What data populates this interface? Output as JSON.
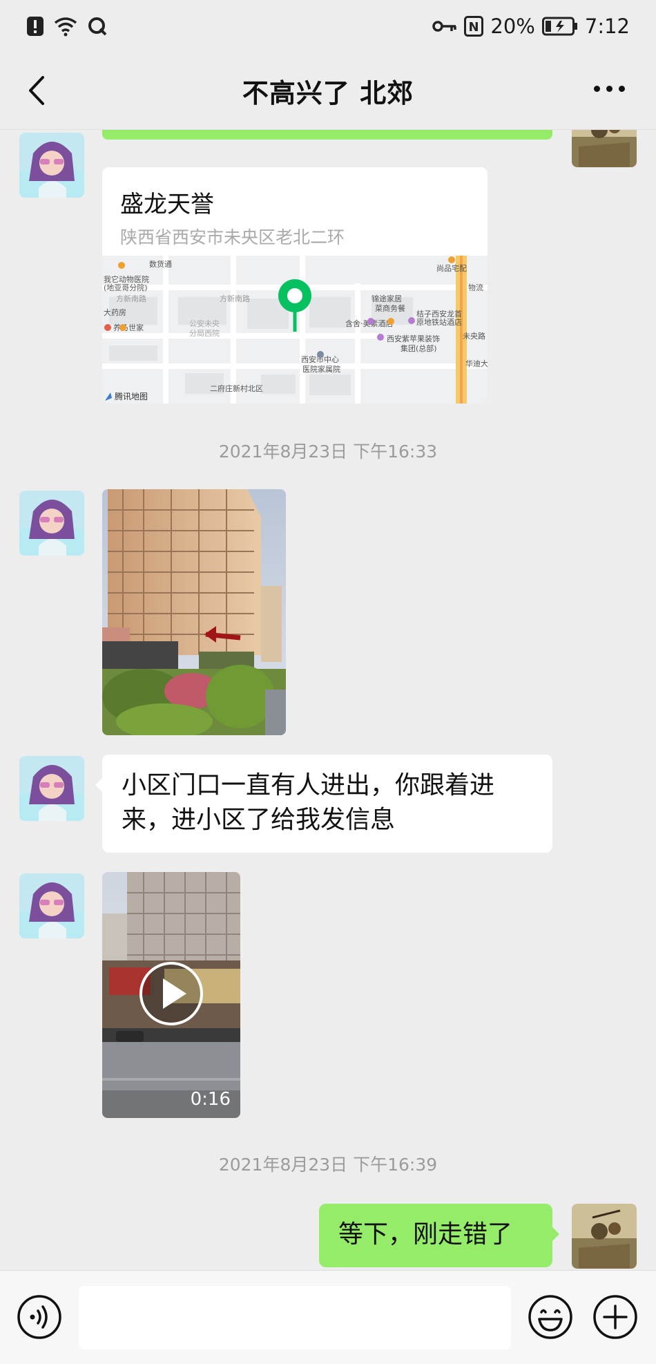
{
  "status_bar": {
    "nfc": "N",
    "battery": "20%",
    "time": "7:12",
    "icons": [
      "alert-icon",
      "wifi-icon",
      "q-app-icon",
      "key-icon",
      "nfc-icon",
      "battery-icon"
    ]
  },
  "nav": {
    "title": "不高兴了  北郊",
    "back_icon": "chevron-left-icon",
    "more_icon": "more-dots-icon"
  },
  "messages": {
    "location": {
      "name": "盛龙天誉",
      "address": "陕西省西安市未央区老北二环",
      "map_labels": [
        "数货通",
        "我它动物医院",
        "(地亚哥分院)",
        "方新南路",
        "方新南路",
        "公安未央",
        "分局西院",
        "大药房",
        "养乃世家",
        "西安市中心",
        "医院家属院",
        "二府庄新村北区",
        "锦途家居",
        "菜商务餐",
        "含舍·美素酒店",
        "桔子西安龙首",
        "原地铁站酒店",
        "西安紫苹果装饰",
        "集团(总部)",
        "尚品宅配",
        "物流",
        "未央路",
        "华迪大"
      ],
      "map_brand": "腾讯地图"
    },
    "timestamp_1": "2021年8月23日 下午16:33",
    "text_1": "小区门口一直有人进出，你跟着进来，进小区了给我发信息",
    "video_duration": "0:16",
    "timestamp_2": "2021年8月23日 下午16:39",
    "text_2": "等下，刚走错了"
  },
  "input_bar": {
    "voice_icon": "voice-icon",
    "input_value": "",
    "emoji_icon": "emoji-icon",
    "plus_icon": "plus-icon"
  },
  "colors": {
    "background": "#ededed",
    "bubble_self": "#95ec69",
    "bubble_other": "#ffffff",
    "timestamp": "#9b9b9b",
    "map_pin": "#07c160"
  }
}
